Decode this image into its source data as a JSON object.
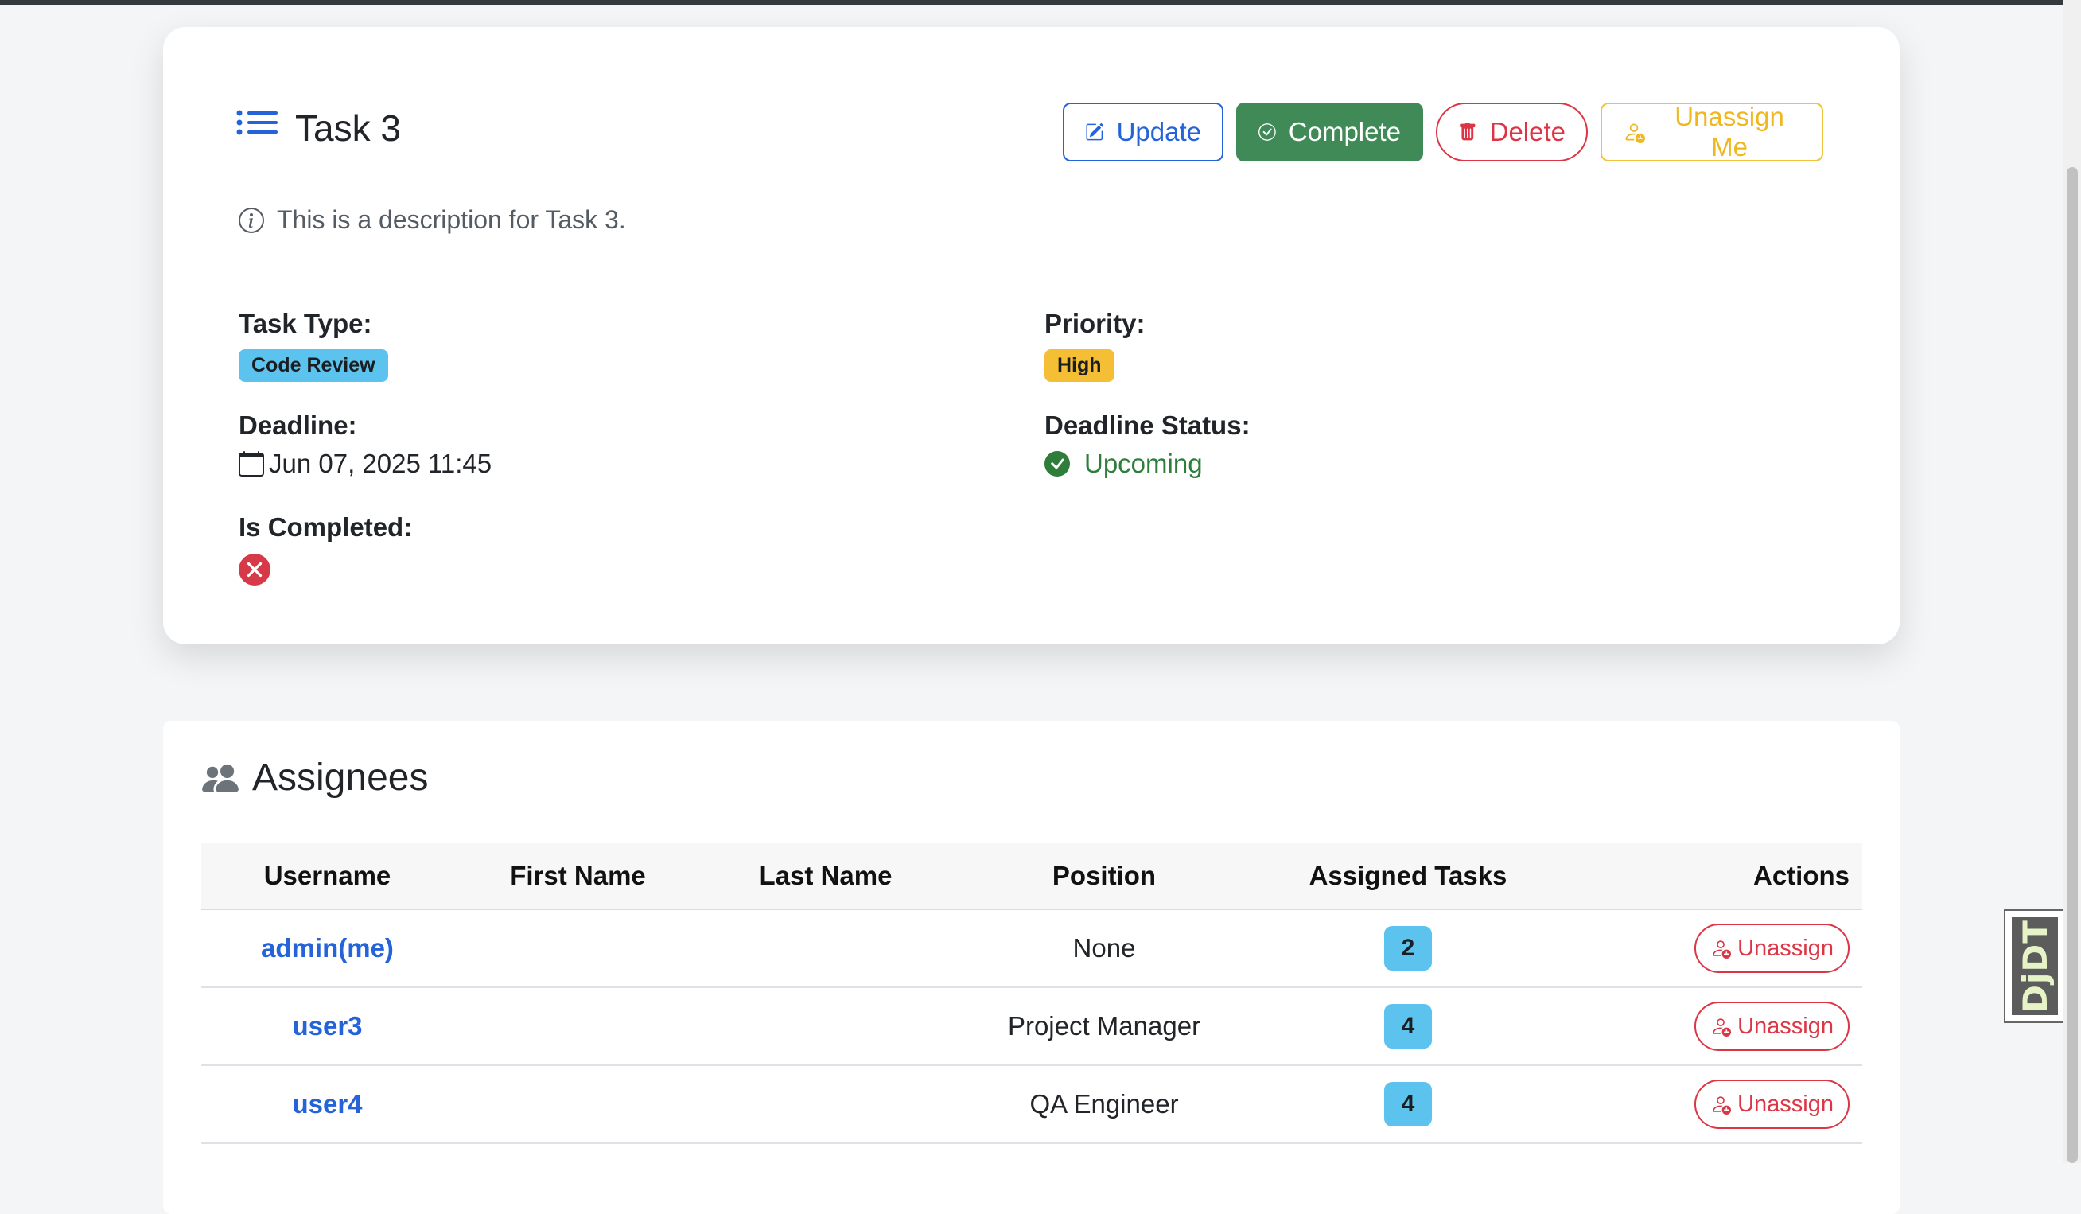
{
  "task": {
    "title": "Task 3",
    "description": "This is a description for Task 3.",
    "actions": {
      "update": "Update",
      "complete": "Complete",
      "delete": "Delete",
      "unassign_me": "Unassign Me"
    },
    "fields": {
      "task_type_label": "Task Type:",
      "task_type_value": "Code Review",
      "priority_label": "Priority:",
      "priority_value": "High",
      "deadline_label": "Deadline:",
      "deadline_value": "Jun 07, 2025 11:45",
      "deadline_status_label": "Deadline Status:",
      "deadline_status_value": "Upcoming",
      "is_completed_label": "Is Completed:",
      "is_completed": false
    }
  },
  "assignees": {
    "title": "Assignees",
    "columns": [
      "Username",
      "First Name",
      "Last Name",
      "Position",
      "Assigned Tasks",
      "Actions"
    ],
    "rows": [
      {
        "username": "admin(me)",
        "first_name": "",
        "last_name": "",
        "position": "None",
        "assigned_tasks": "2",
        "action": "Unassign"
      },
      {
        "username": "user3",
        "first_name": "",
        "last_name": "",
        "position": "Project Manager",
        "assigned_tasks": "4",
        "action": "Unassign"
      },
      {
        "username": "user4",
        "first_name": "",
        "last_name": "",
        "position": "QA Engineer",
        "assigned_tasks": "4",
        "action": "Unassign"
      }
    ]
  },
  "debug_toolbar": {
    "label": "DjDT"
  },
  "colors": {
    "primary": "#2563d8",
    "success": "#3f8a57",
    "danger": "#dc3545",
    "warning": "#f4be35",
    "info": "#5bc3ee"
  },
  "icons": {
    "task_header": "list-icon",
    "update": "pencil-square-icon",
    "complete": "check-circle-icon",
    "delete": "trash-icon",
    "unassign_me": "person-dash-icon",
    "description": "info-circle-icon",
    "deadline": "calendar-icon",
    "deadline_status": "check-circle-fill-icon",
    "is_completed": "x-circle-fill-icon",
    "assignees": "people-icon",
    "row_unassign": "person-dash-icon"
  }
}
